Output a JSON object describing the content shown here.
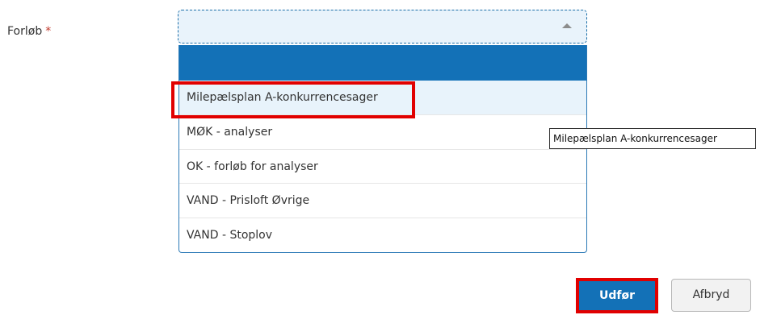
{
  "form": {
    "field_label": "Forløb",
    "required_marker": "*",
    "select_value": ""
  },
  "dropdown": {
    "options": [
      {
        "label": "Milepælsplan A-konkurrencesager",
        "highlighted": true
      },
      {
        "label": "MØK - analyser",
        "highlighted": false
      },
      {
        "label": "OK - forløb for analyser",
        "highlighted": false
      },
      {
        "label": "VAND - Prisloft Øvrige",
        "highlighted": false
      },
      {
        "label": "VAND - Stoplov",
        "highlighted": false
      }
    ]
  },
  "tooltip": {
    "text": "Milepælsplan A-konkurrencesager"
  },
  "buttons": {
    "submit_label": "Udfør",
    "cancel_label": "Afbryd"
  },
  "colors": {
    "primary": "#1371b7",
    "highlight_outline": "#e10000",
    "required": "#c0392b",
    "option_hover": "#e8f3fb"
  }
}
